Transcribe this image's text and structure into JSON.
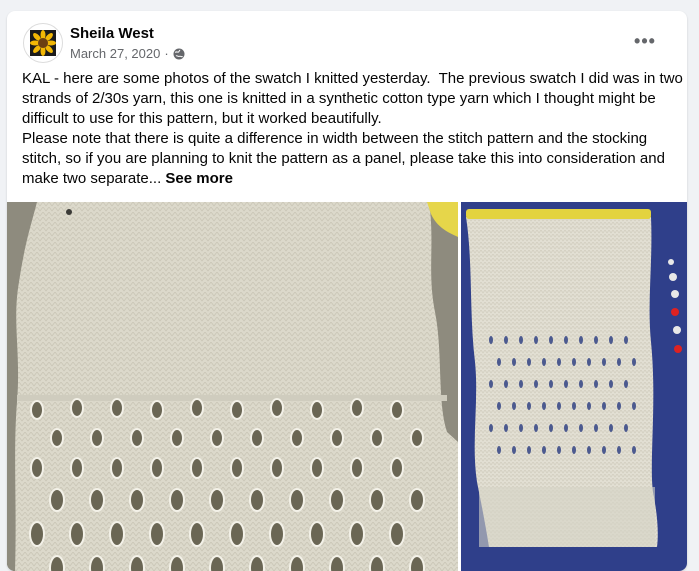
{
  "post": {
    "author": "Sheila West",
    "date": "March 27, 2020",
    "separator": "·",
    "privacy_icon": "globe-icon",
    "more_icon": "more-options-icon",
    "more_label": "•••",
    "text": "KAL - here are some photos of the swatch I knitted yesterday.  The previous swatch I did was in two strands of 2/30s yarn, this one is knitted in a synthetic cotton type yarn which I thought might be difficult to use for this pattern, but it worked beautifully.\nPlease note that there is quite a difference in width between the stitch pattern and the stocking stitch, so if you are planning to knit the pattern as a panel, please take this into consideration and make two separate... ",
    "see_more": "See more"
  },
  "colors": {
    "text": "#050505",
    "meta": "#65676b",
    "yarn": "#d9d6c8",
    "board": "#2f3f8a"
  }
}
